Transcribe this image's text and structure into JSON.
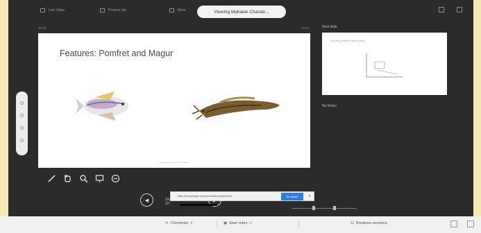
{
  "top_bar": {
    "items": [
      {
        "label": "Live Video",
        "icon": "video-icon"
      },
      {
        "label": "Present tab",
        "icon": "share-icon"
      },
      {
        "label": "More",
        "icon": "more-icon"
      }
    ],
    "viewing_banner": "Viewing Mahalok Chande..."
  },
  "presenter": {
    "elapsed_time": "00:00",
    "clock": "10:11",
    "slide": {
      "title": "Features: Pomfret and Magur",
      "footer": "Pomfret and Magur fish features"
    },
    "next_slide": {
      "heading": "Next slide",
      "title": "Two fast profiles; Feature space"
    },
    "notes": "No Notes",
    "page_counter": "Slide 3/7",
    "toast": {
      "text": "https://docs.google.com/presentation/d/presenter",
      "button": "Re-share",
      "close": "✕"
    },
    "colors": {
      "frame": "#2b2b2b",
      "accent": "#2f7de1"
    },
    "tool_icons": [
      "pen-icon",
      "hand-icon",
      "zoom-icon",
      "screen-icon",
      "minus-circle-icon"
    ]
  },
  "taskbar": {
    "items": [
      {
        "label": "Chemicals",
        "icon": "pen-icon"
      },
      {
        "label": "Start video",
        "icon": "video-icon"
      },
      {
        "label": "Breakout sessions",
        "icon": "people-icon"
      }
    ]
  }
}
